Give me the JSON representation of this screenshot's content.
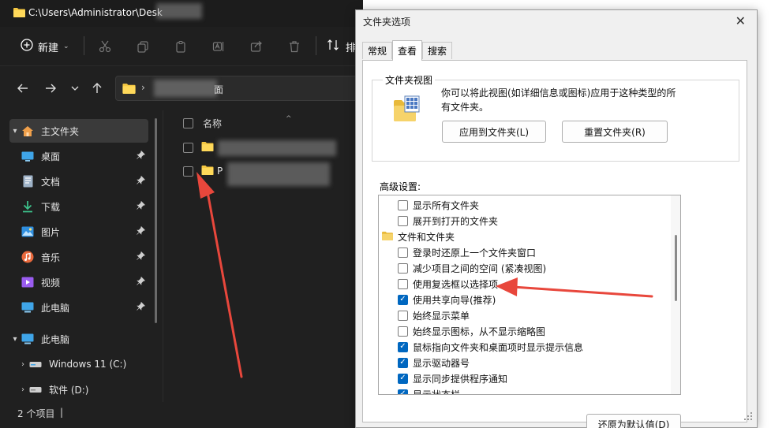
{
  "explorer": {
    "title_path": "C:\\Users\\Administrator\\Desk",
    "toolbar": {
      "new_label": "新建",
      "sort_label": "排"
    },
    "address": {
      "breadcrumb_tail": "面"
    },
    "sidebar": [
      {
        "label": "主文件夹",
        "icon": "home-icon",
        "expand": "▾",
        "selected": true
      },
      {
        "label": "桌面",
        "icon": "desktop-icon",
        "pinned": true
      },
      {
        "label": "文档",
        "icon": "document-icon",
        "pinned": true
      },
      {
        "label": "下载",
        "icon": "download-icon",
        "pinned": true
      },
      {
        "label": "图片",
        "icon": "picture-icon",
        "pinned": true
      },
      {
        "label": "音乐",
        "icon": "music-icon",
        "pinned": true
      },
      {
        "label": "视频",
        "icon": "video-icon",
        "pinned": true
      },
      {
        "label": "此电脑",
        "icon": "computer-icon",
        "pinned": true
      },
      {
        "label": "此电脑",
        "icon": "computer-icon",
        "expand": "▾"
      },
      {
        "label": "Windows 11 (C:)",
        "icon": "drive-icon",
        "expand": "›"
      },
      {
        "label": "软件 (D:)",
        "icon": "drive-icon",
        "expand": "›"
      }
    ],
    "filelist": {
      "header_name": "名称",
      "files": [
        {
          "name": ""
        },
        {
          "name": "P"
        }
      ]
    },
    "status": {
      "item_count": "2 个项目",
      "cursor": "|"
    }
  },
  "dialog": {
    "title": "文件夹选项",
    "close": "✕",
    "tabs": [
      "常规",
      "查看",
      "搜索"
    ],
    "active_tab": 1,
    "folder_views": {
      "title": "文件夹视图",
      "description": "你可以将此视图(如详细信息或图标)应用于这种类型的所有文件夹。",
      "apply_button": "应用到文件夹(L)",
      "reset_button": "重置文件夹(R)"
    },
    "advanced": {
      "title": "高级设置:",
      "items": [
        {
          "label": "显示所有文件夹",
          "type": "checkbox",
          "checked": false
        },
        {
          "label": "展开到打开的文件夹",
          "type": "checkbox",
          "checked": false
        },
        {
          "label": "文件和文件夹",
          "type": "folder"
        },
        {
          "label": "登录时还原上一个文件夹窗口",
          "type": "checkbox",
          "checked": false
        },
        {
          "label": "减少项目之间的空间 (紧凑视图)",
          "type": "checkbox",
          "checked": false
        },
        {
          "label": "使用复选框以选择项",
          "type": "checkbox",
          "checked": false
        },
        {
          "label": "使用共享向导(推荐)",
          "type": "checkbox",
          "checked": true
        },
        {
          "label": "始终显示菜单",
          "type": "checkbox",
          "checked": false
        },
        {
          "label": "始终显示图标，从不显示缩略图",
          "type": "checkbox",
          "checked": false
        },
        {
          "label": "鼠标指向文件夹和桌面项时显示提示信息",
          "type": "checkbox",
          "checked": true
        },
        {
          "label": "显示驱动器号",
          "type": "checkbox",
          "checked": true
        },
        {
          "label": "显示同步提供程序通知",
          "type": "checkbox",
          "checked": true
        },
        {
          "label": "显示状态栏",
          "type": "checkbox",
          "checked": true
        }
      ]
    },
    "restore_button": "还原为默认值(D)"
  },
  "colors": {
    "accent": "#0067c0",
    "explorer_bg": "#202020",
    "arrow": "#e8473c"
  }
}
